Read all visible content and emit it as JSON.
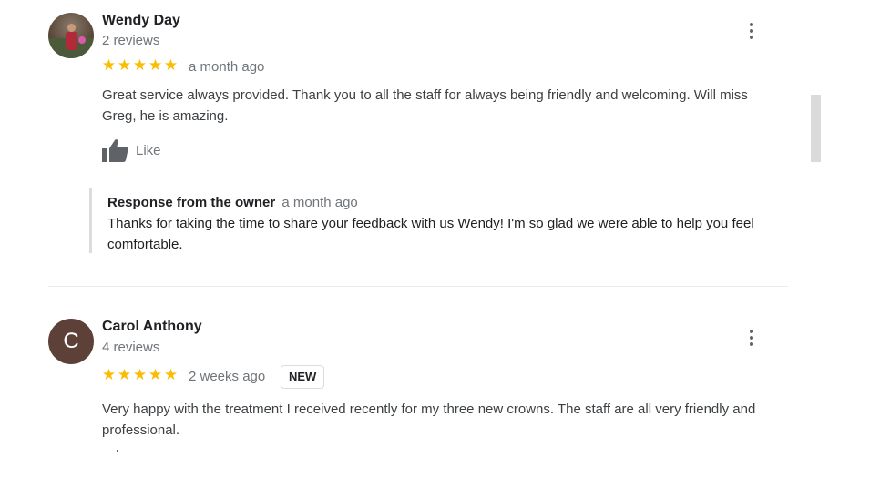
{
  "reviews": [
    {
      "name": "Wendy Day",
      "review_count": "2 reviews",
      "rating": 5,
      "stars": "★★★★★",
      "date": "a month ago",
      "text": "Great service always provided. Thank you to all the staff for always being friendly and welcoming. Will miss Greg, he is amazing.",
      "like_label": "Like",
      "owner_response": {
        "title": "Response from the owner",
        "date": "a month ago",
        "text": "Thanks for taking the time to share your feedback with us Wendy! I'm so glad we were able to help you feel comfortable."
      }
    },
    {
      "name": "Carol Anthony",
      "avatar_letter": "C",
      "review_count": "4 reviews",
      "rating": 5,
      "stars": "★★★★★",
      "date": "2 weeks ago",
      "badge": "NEW",
      "text": "Very happy with the treatment I received recently for my three new crowns. The staff are all very friendly and professional."
    }
  ],
  "colors": {
    "star": "#fbbc04",
    "avatar_carol": "#5d4037",
    "secondary_text": "#70757a",
    "divider": "#e8eaed"
  },
  "icons": {
    "more": "more-vert-icon",
    "like": "thumb-up-icon"
  }
}
